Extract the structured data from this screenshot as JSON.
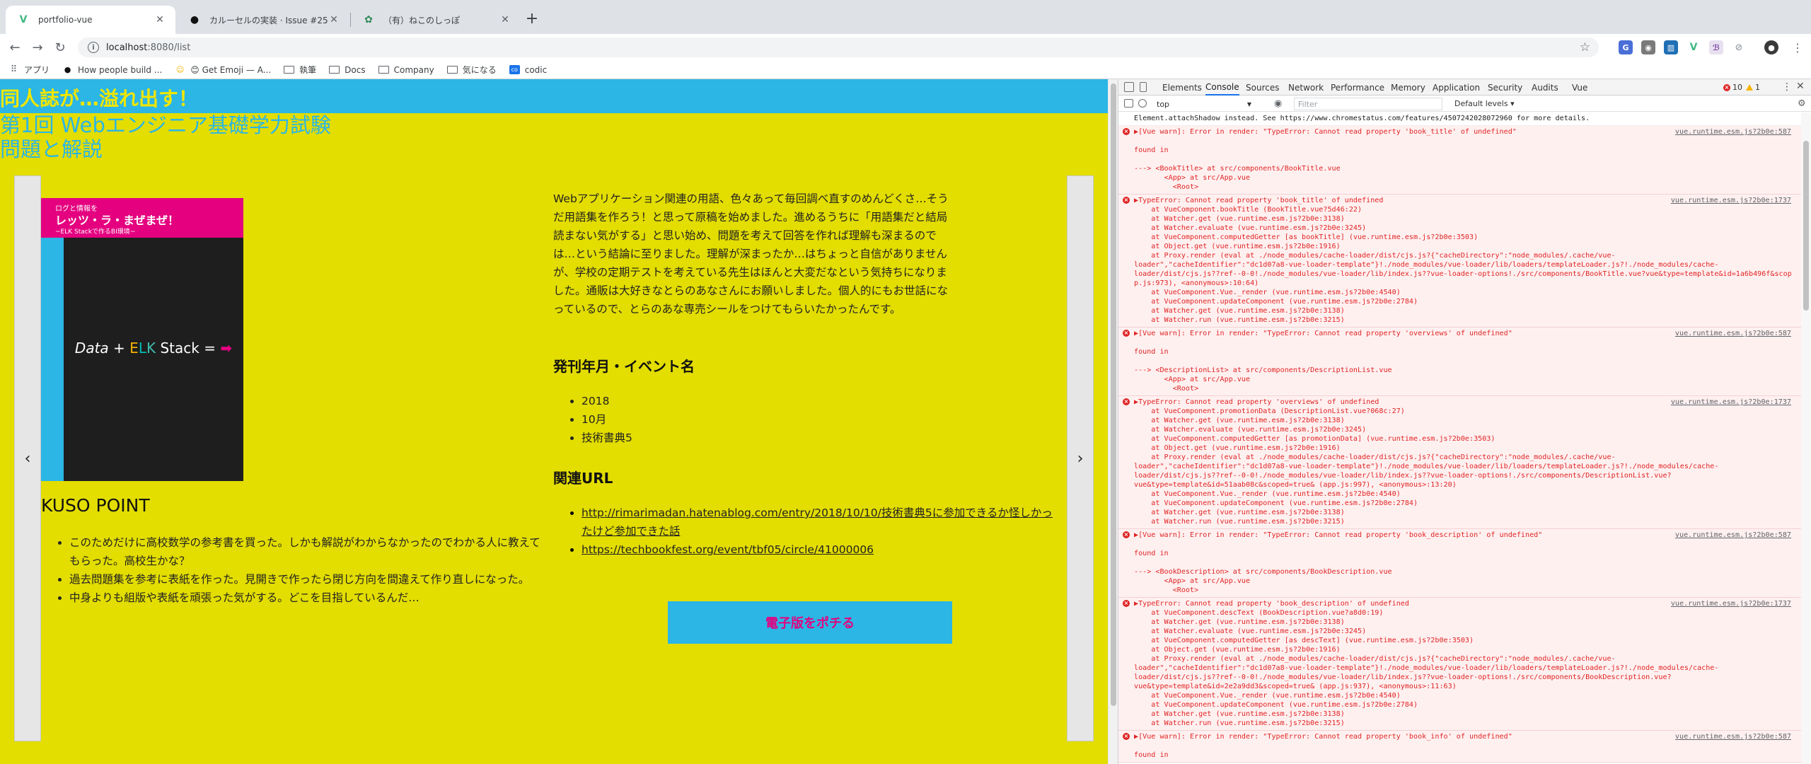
{
  "browser": {
    "tabs": [
      {
        "title": "portfolio-vue",
        "active": true
      },
      {
        "title": "カルーセルの実装 · Issue #25 · M",
        "active": false
      },
      {
        "title": "（有）ねこのしっぽ",
        "active": false
      }
    ],
    "url_host": "localhost",
    "url_path": ":8080/list",
    "bookmarks": [
      "アプリ",
      "How people build ...",
      "😊 Get Emoji — A...",
      "執筆",
      "Docs",
      "Company",
      "気になる",
      "codic"
    ]
  },
  "page": {
    "site_title": "同人誌が…溢れ出す！",
    "title_line1": "第1回 Webエンジニア基礎学力試験",
    "title_line2": "問題と解説",
    "prev_label": "‹",
    "next_label": "›",
    "cover": {
      "sub": "ログと情報を",
      "main": "レッツ・ラ・まぜまぜ！",
      "tag": "~ELK Stackで作るBI環境~",
      "data": "Data",
      "plus": "+",
      "e": "E",
      "l": "L",
      "k": "K",
      "stack": "Stack",
      "equals": "=",
      "arrow": "➡"
    },
    "kuso_title": "KUSO POINT",
    "kuso_points": [
      "このためだけに高校数学の参考書を買った。しかも解説がわからなかったのでわかる人に教えてもらった。高校生かな？",
      "過去問題集を参考に表紙を作った。見開きで作ったら閉じ方向を間違えて作り直しになった。",
      "中身よりも組版や表紙を頑張った気がする。どこを目指しているんだ…"
    ],
    "description": "Webアプリケーション関連の用語、色々あって毎回調べ直すのめんどくさ…そうだ用語集を作ろう！と思って原稿を始めました。進めるうちに「用語集だと結局読まない気がする」と思い始め、問題を考えて回答を作れば理解も深まるのでは…という結論に至りました。理解が深まったか…はちょっと自信がありませんが、学校の定期テストを考えている先生はほんと大変だなという気持ちになりました。通販は大好きなとらのあなさんにお願いしました。個人的にもお世話になっているので、とらのあな専売シールをつけてもらいたかったんです。",
    "pub_heading": "発刊年月・イベント名",
    "pub_items": [
      "2018",
      "10月",
      "技術書典5"
    ],
    "url_heading": "関連URL",
    "urls": [
      "http://rimarimadan.hatenablog.com/entry/2018/10/10/技術書典5に参加できるか怪しかったけど参加できた話",
      "https://techbookfest.org/event/tbf05/circle/41000006"
    ],
    "buy_label": "電子版をポチる"
  },
  "devtools": {
    "tabs": [
      "Elements",
      "Console",
      "Sources",
      "Network",
      "Performance",
      "Memory",
      "Application",
      "Security",
      "Audits",
      "Vue"
    ],
    "active_tab": "Console",
    "error_count": "10",
    "warning_count": "1",
    "context": "top",
    "filter_placeholder": "Filter",
    "levels": "Default levels ▾",
    "messages": [
      {
        "kind": "plain",
        "icon": false,
        "src": "",
        "lines": [
          "Element.attachShadow instead. See https://www.chromestatus.com/features/4507242028072960 for more details."
        ]
      },
      {
        "kind": "err",
        "icon": true,
        "src": "vue.runtime.esm.js?2b0e:587",
        "lines": [
          "▶[Vue warn]: Error in render: \"TypeError: Cannot read property 'book_title' of undefined\"",
          "",
          "found in",
          "",
          "---> <BookTitle> at src/components/BookTitle.vue",
          "       <App> at src/App.vue",
          "         <Root>"
        ]
      },
      {
        "kind": "err",
        "icon": true,
        "src": "vue.runtime.esm.js?2b0e:1737",
        "lines": [
          "▶TypeError: Cannot read property 'book_title' of undefined",
          "    at VueComponent.bookTitle (BookTitle.vue?5d46:22)",
          "    at Watcher.get (vue.runtime.esm.js?2b0e:3138)",
          "    at Watcher.evaluate (vue.runtime.esm.js?2b0e:3245)",
          "    at VueComponent.computedGetter [as bookTitle] (vue.runtime.esm.js?2b0e:3503)",
          "    at Object.get (vue.runtime.esm.js?2b0e:1916)",
          "    at Proxy.render (eval at ./node_modules/cache-loader/dist/cjs.js?{\"cacheDirectory\":\"node_modules/.cache/vue-",
          "loader\",\"cacheIdentifier\":\"dc1d07a8-vue-loader-template\"}!./node_modules/vue-loader/lib/loaders/templateLoader.js?!./node_modules/cache-",
          "loader/dist/cjs.js??ref--0-0!./node_modules/vue-loader/lib/index.js??vue-loader-options!./src/components/BookTitle.vue?vue&type=template&id=1a6b496f&scoped=true& (ap",
          "p.js:973), <anonymous>:10:64)",
          "    at VueComponent.Vue._render (vue.runtime.esm.js?2b0e:4540)",
          "    at VueComponent.updateComponent (vue.runtime.esm.js?2b0e:2784)",
          "    at Watcher.get (vue.runtime.esm.js?2b0e:3138)",
          "    at Watcher.run (vue.runtime.esm.js?2b0e:3215)"
        ]
      },
      {
        "kind": "err",
        "icon": true,
        "src": "vue.runtime.esm.js?2b0e:587",
        "lines": [
          "▶[Vue warn]: Error in render: \"TypeError: Cannot read property 'overviews' of undefined\"",
          "",
          "found in",
          "",
          "---> <DescriptionList> at src/components/DescriptionList.vue",
          "       <App> at src/App.vue",
          "         <Root>"
        ]
      },
      {
        "kind": "err",
        "icon": true,
        "src": "vue.runtime.esm.js?2b0e:1737",
        "lines": [
          "▶TypeError: Cannot read property 'overviews' of undefined",
          "    at VueComponent.promotionData (DescriptionList.vue?068c:27)",
          "    at Watcher.get (vue.runtime.esm.js?2b0e:3138)",
          "    at Watcher.evaluate (vue.runtime.esm.js?2b0e:3245)",
          "    at VueComponent.computedGetter [as promotionData] (vue.runtime.esm.js?2b0e:3503)",
          "    at Object.get (vue.runtime.esm.js?2b0e:1916)",
          "    at Proxy.render (eval at ./node_modules/cache-loader/dist/cjs.js?{\"cacheDirectory\":\"node_modules/.cache/vue-",
          "loader\",\"cacheIdentifier\":\"dc1d07a8-vue-loader-template\"}!./node_modules/vue-loader/lib/loaders/templateLoader.js?!./node_modules/cache-",
          "loader/dist/cjs.js??ref--0-0!./node_modules/vue-loader/lib/index.js??vue-loader-options!./src/components/DescriptionList.vue?",
          "vue&type=template&id=51aab08c&scoped=true& (app.js:997), <anonymous>:13:20)",
          "    at VueComponent.Vue._render (vue.runtime.esm.js?2b0e:4540)",
          "    at VueComponent.updateComponent (vue.runtime.esm.js?2b0e:2784)",
          "    at Watcher.get (vue.runtime.esm.js?2b0e:3138)",
          "    at Watcher.run (vue.runtime.esm.js?2b0e:3215)"
        ]
      },
      {
        "kind": "err",
        "icon": true,
        "src": "vue.runtime.esm.js?2b0e:587",
        "lines": [
          "▶[Vue warn]: Error in render: \"TypeError: Cannot read property 'book_description' of undefined\"",
          "",
          "found in",
          "",
          "---> <BookDescription> at src/components/BookDescription.vue",
          "       <App> at src/App.vue",
          "         <Root>"
        ]
      },
      {
        "kind": "err",
        "icon": true,
        "src": "vue.runtime.esm.js?2b0e:1737",
        "lines": [
          "▶TypeError: Cannot read property 'book_description' of undefined",
          "    at VueComponent.descText (BookDescription.vue?a8d0:19)",
          "    at Watcher.get (vue.runtime.esm.js?2b0e:3138)",
          "    at Watcher.evaluate (vue.runtime.esm.js?2b0e:3245)",
          "    at VueComponent.computedGetter [as descText] (vue.runtime.esm.js?2b0e:3503)",
          "    at Object.get (vue.runtime.esm.js?2b0e:1916)",
          "    at Proxy.render (eval at ./node_modules/cache-loader/dist/cjs.js?{\"cacheDirectory\":\"node_modules/.cache/vue-",
          "loader\",\"cacheIdentifier\":\"dc1d07a8-vue-loader-template\"}!./node_modules/vue-loader/lib/loaders/templateLoader.js?!./node_modules/cache-",
          "loader/dist/cjs.js??ref--0-0!./node_modules/vue-loader/lib/index.js??vue-loader-options!./src/components/BookDescription.vue?",
          "vue&type=template&id=2e2a9dd3&scoped=true& (app.js:937), <anonymous>:11:63)",
          "    at VueComponent.Vue._render (vue.runtime.esm.js?2b0e:4540)",
          "    at VueComponent.updateComponent (vue.runtime.esm.js?2b0e:2784)",
          "    at Watcher.get (vue.runtime.esm.js?2b0e:3138)",
          "    at Watcher.run (vue.runtime.esm.js?2b0e:3215)"
        ]
      },
      {
        "kind": "err",
        "icon": true,
        "src": "vue.runtime.esm.js?2b0e:587",
        "lines": [
          "▶[Vue warn]: Error in render: \"TypeError: Cannot read property 'book_info' of undefined\"",
          "",
          "found in"
        ]
      }
    ]
  }
}
